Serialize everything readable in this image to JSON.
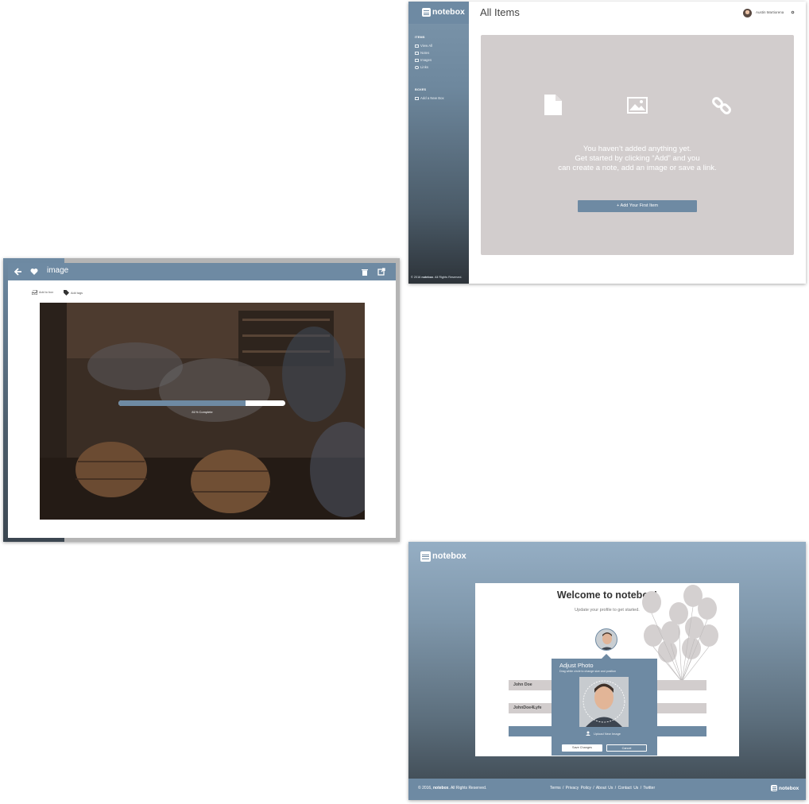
{
  "brand": {
    "name": "notebox",
    "accent": "#6e8aa3",
    "empty_gray": "#d2cdcd"
  },
  "all_items": {
    "title": "All Items",
    "sidebar": {
      "items_heading": "ITEMS",
      "items": [
        {
          "label": "View All",
          "icon": "grid-icon"
        },
        {
          "label": "Notes",
          "icon": "note-icon"
        },
        {
          "label": "Images",
          "icon": "image-icon"
        },
        {
          "label": "Links",
          "icon": "link-icon"
        }
      ],
      "boxes_heading": "BOXES",
      "add_box": "Add a New Box",
      "copyright_prefix": "© 2016",
      "copyright_brand": "notebox",
      "copyright_suffix": ". All Rights Reserved."
    },
    "user": {
      "name": "Austin Martiorena"
    },
    "empty_state": {
      "line1": "You haven’t added anything yet.",
      "line2": "Get started by clicking “Add” and you",
      "line3": "can create a note, add an image or save a link."
    },
    "add_button": "+ Add Your First Item"
  },
  "image_view": {
    "title": "image",
    "add_to_box": "Add to box",
    "add_tags": "Add tags",
    "progress": {
      "percent": 0.76,
      "label": "81% Complete"
    }
  },
  "welcome": {
    "title": "Welcome to notebox!",
    "subtitle": "Update your profile to get started.",
    "fields": {
      "name": "John Doe",
      "username": "JohnDoe4Lyfe"
    },
    "popover": {
      "title": "Adjust Photo",
      "hint": "Drag white circle to change size and position",
      "upload": "Upload New Image",
      "save": "Save Changes",
      "cancel": "Cancel"
    },
    "footer": {
      "copyright_prefix": "© 2016,",
      "copyright_brand": "notebox",
      "copyright_suffix": ". All Rights Reserved.",
      "links": [
        "Terms",
        "Privacy Policy",
        "About Us",
        "Contact Us",
        "Twitter"
      ]
    }
  }
}
